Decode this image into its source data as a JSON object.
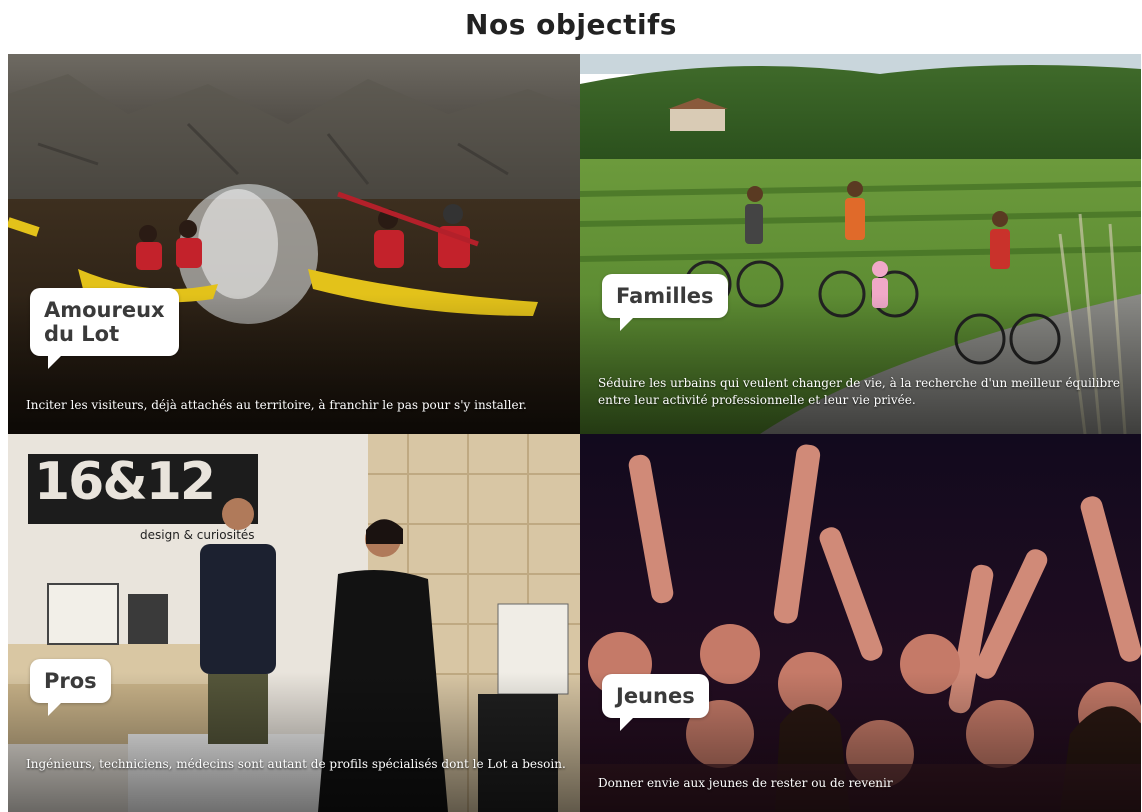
{
  "title": "Nos objectifs",
  "tiles": [
    {
      "label": "Amoureux du Lot",
      "label_line1": "Amoureux",
      "label_line2": "du Lot",
      "caption": "Inciter les visiteurs, déjà attachés au territoire, à franchir le pas pour s'y installer."
    },
    {
      "label": "Familles",
      "caption": "Séduire les urbains qui veulent changer de vie, à la recherche d'un meilleur équilibre entre leur activité professionnelle et leur vie privée."
    },
    {
      "label": "Pros",
      "sign_text": "16&12",
      "sign_subtext": "design & curiosités",
      "caption": "Ingénieurs, techniciens, médecins sont autant de profils spécialisés dont le Lot a besoin."
    },
    {
      "label": "Jeunes",
      "caption": "Donner envie aux jeunes de rester ou de revenir"
    }
  ]
}
